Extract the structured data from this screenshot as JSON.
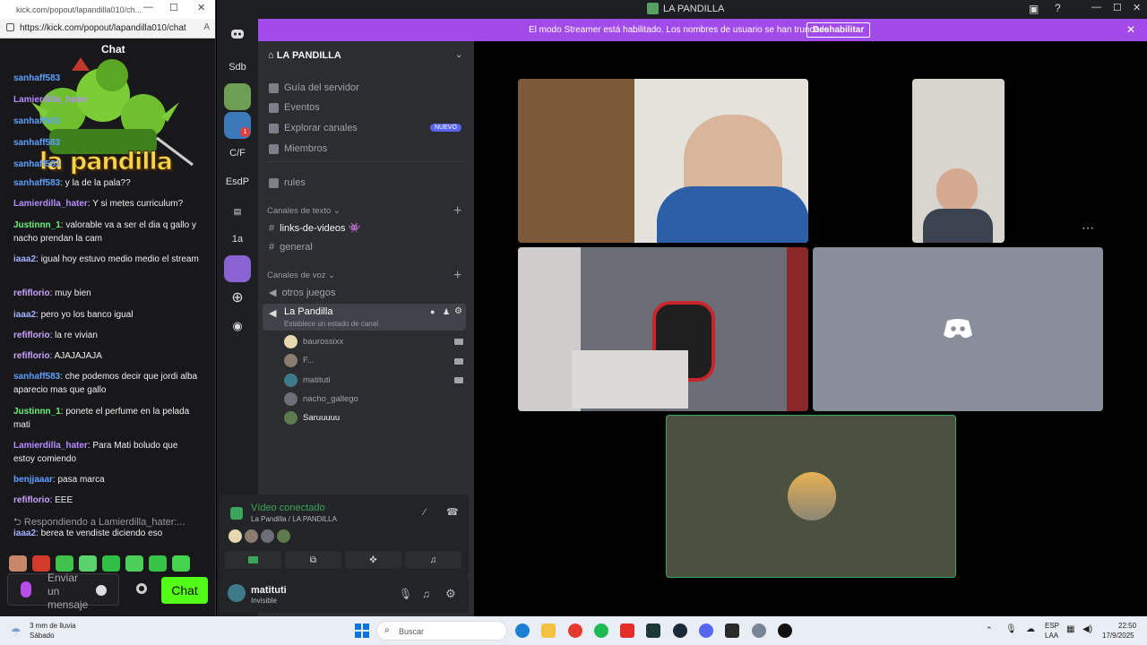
{
  "browser": {
    "title_url": "kick.com/popout/lapandilla010/ch...",
    "address": "https://kick.com/popout/lapandilla010/chat"
  },
  "kick_chat": {
    "header_title": "Chat",
    "overlay_logo_text": "la pandilla",
    "messages": [
      {
        "user": "sanhaff583",
        "text": "",
        "color": "#5ea0ff"
      },
      {
        "user": "Lamierdilla_hater",
        "text": "",
        "color": "#b58dff"
      },
      {
        "user": "sanhaff583",
        "text": "",
        "color": "#5ea0ff"
      },
      {
        "user": "sanhaff583",
        "text": "",
        "color": "#5ea0ff"
      },
      {
        "user": "sanhaff583",
        "text": "",
        "color": "#5ea0ff"
      },
      {
        "user": "sanhaff583",
        "text": ": y la de la pala??",
        "color": "#5ea0ff"
      },
      {
        "user": "Lamierdilla_hater",
        "text": ": Y si metes curriculum?",
        "color": "#b58dff"
      },
      {
        "user": "Justinnn_1",
        "text": ": valorable va a ser el dia q gallo y nacho prendan la cam",
        "color": "#6cf07a"
      },
      {
        "user": "iaaa2",
        "text": ": igual hoy estuvo medio medio el stream",
        "color": "#9fb3ff"
      },
      {
        "user": "refiflorio",
        "text": ": muy bien",
        "color": "#c8a3ff"
      },
      {
        "user": "iaaa2",
        "text": ": pero yo los banco igual",
        "color": "#9fb3ff"
      },
      {
        "user": "refiflorio",
        "text": ": la re vivian",
        "color": "#c8a3ff"
      },
      {
        "user": "refiflorio",
        "text": ": AJAJAJAJA",
        "color": "#c8a3ff"
      },
      {
        "user": "sanhaff583",
        "text": ": che podemos decir que jordi alba aparecio mas que gallo",
        "color": "#5ea0ff"
      },
      {
        "user": "Justinnn_1",
        "text": ": ponete el perfume en la pelada mati",
        "color": "#6cf07a"
      },
      {
        "user": "Lamierdilla_hater",
        "text": ": Para Mati boludo que estoy comiendo",
        "color": "#b58dff"
      },
      {
        "user": "benjjaaar",
        "text": ": pasa marca",
        "color": "#5ea0ff"
      },
      {
        "user": "refiflorio",
        "text": ": EEE",
        "color": "#c8a3ff"
      }
    ],
    "reply_to": "Respondiendo a Lamierdilla_hater:...",
    "reply_message": {
      "user": "iaaa2",
      "text": ": berea te vendiste diciendo eso",
      "color": "#9fb3ff"
    },
    "input_placeholder": "Enviar un mensaje",
    "send_label": "Chat"
  },
  "discord": {
    "window_title": "LA PANDILLA",
    "streamer_banner": "El modo Streamer está habilitado. Los nombres de usuario se han truncado.",
    "banner_button": "Deshabilitar",
    "server_name": "LA PANDILLA",
    "rail": [
      "Sdb",
      "C/F",
      "EsdP",
      "1a"
    ],
    "rail_badge": "1",
    "menu": [
      {
        "label": "Guía del servidor"
      },
      {
        "label": "Eventos"
      },
      {
        "label": "Explorar canales",
        "badge": "NUEVO"
      },
      {
        "label": "Miembros"
      }
    ],
    "rules_channel": "rules",
    "text_category": "Canales de texto",
    "text_channels": [
      "links-de-videos 👾",
      "general"
    ],
    "voice_category": "Canales de voz",
    "voice_channels": [
      "otros juegos"
    ],
    "active_voice": {
      "name": "La Pandilla",
      "status": "Establece un estado de canal"
    },
    "members": [
      "baurossixx",
      "F...",
      "matituti",
      "nacho_gallego",
      "Saruuuuu"
    ],
    "video_status": "Vídeo conectado",
    "video_location": "La Pandilla / LA PANDILLA",
    "user_name": "matituti",
    "user_status": "Invisible",
    "more_dots": "⋯"
  },
  "taskbar": {
    "weather": "3 mm de lluvia",
    "day": "Sábado",
    "search_placeholder": "Buscar",
    "lang": "ESP",
    "lang2": "LAA",
    "time": "22:50",
    "date": "17/9/2025"
  },
  "colors": {
    "discord_accent": "#a34bea",
    "kick_green": "#53fc18"
  }
}
